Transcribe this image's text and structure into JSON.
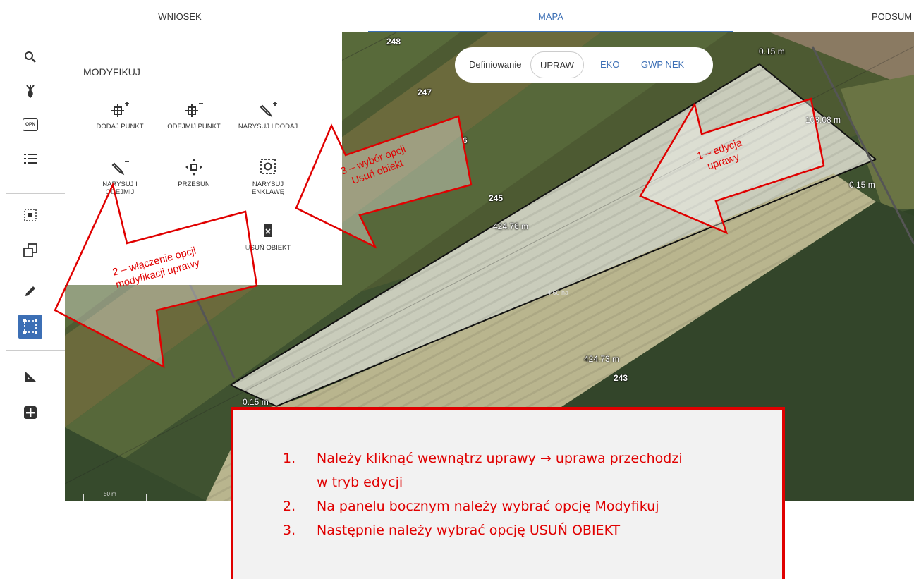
{
  "nav": {
    "tabs": [
      {
        "label": "WNIOSEK",
        "active": false
      },
      {
        "label": "MAPA",
        "active": true
      },
      {
        "label": "PODSUM",
        "active": false
      }
    ]
  },
  "sidebar": {
    "icons": [
      "search-icon",
      "plant-icon",
      "opn-icon",
      "list-icon",
      "select-area-icon",
      "copy-icon",
      "pencil-icon",
      "modify-icon",
      "measure-icon",
      "add-icon"
    ],
    "opn_label": "OPN",
    "active": "modify-icon"
  },
  "panel": {
    "title": "MODYFIKUJ",
    "tools": [
      {
        "label": "DODAJ PUNKT",
        "icon": "add-point-icon"
      },
      {
        "label": "ODEJMIJ PUNKT",
        "icon": "remove-point-icon"
      },
      {
        "label": "NARYSUJ I DODAJ",
        "icon": "draw-add-icon"
      },
      {
        "label": "NARYSUJ I ODEJMIJ",
        "icon": "draw-subtract-icon"
      },
      {
        "label": "PRZESUŃ",
        "icon": "move-icon"
      },
      {
        "label": "NARYSUJ ENKLAWĘ",
        "icon": "enclave-icon"
      },
      {
        "label": "USUŃ OBIEKT",
        "icon": "delete-object-icon"
      }
    ]
  },
  "definiowanie": {
    "label": "Definiowanie",
    "options": [
      "UPRAW",
      "EKO",
      "GWP NEK"
    ],
    "selected": "UPRAW"
  },
  "map": {
    "labels": {
      "p248": "248",
      "p247": "247",
      "p6": "6",
      "p245": "245",
      "p243": "243",
      "len_top": "424.76 m",
      "len_bottom": "424.73 m",
      "len_right": "108.08 m",
      "d1": "0.15 m",
      "d2": "0.15 m",
      "d3": "0.15 m",
      "area": "4.60 ha"
    },
    "scale": "50 m"
  },
  "annotations": {
    "arrow1": "1 – edycja\nuprawy",
    "arrow2": "2 – włączenie opcji\nmodyfikacji uprawy",
    "arrow3": "3 – wybór opcji\nUsuń obiekt"
  },
  "instructions": {
    "items": [
      {
        "num": "1.",
        "text": "Należy kliknąć wewnątrz uprawy → uprawa przechodzi w tryb edycji"
      },
      {
        "num": "2.",
        "text": "Na panelu bocznym należy wybrać opcję Modyfikuj"
      },
      {
        "num": "3.",
        "text": "Następnie należy wybrać opcję USUŃ OBIEKT"
      }
    ]
  },
  "colors": {
    "accent": "#3c6fb5",
    "annotation": "#e00000"
  }
}
